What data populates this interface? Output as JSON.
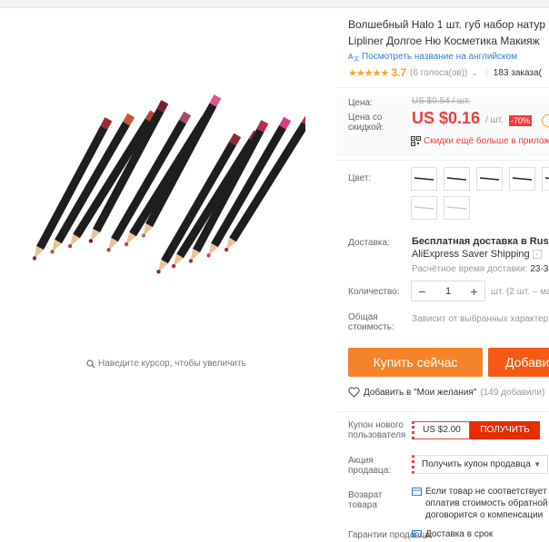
{
  "product": {
    "title_line1": "Волшебный Halo 1 шт. губ набор натур",
    "title_line2": "Lipliner Долгое Ню Косметика Макияж",
    "translate_link": "Посмотреть название на английском",
    "rating_stars": "★★★★★",
    "rating_value": "3.7",
    "votes": "(6 голоса(ов))",
    "votes_chevron": "⌄",
    "orders": "183 заказа(",
    "zoom_hint": "Наведите курсор, чтобы увеличить",
    "image_icon": "lip-pencils-photo"
  },
  "price": {
    "label": "Цена:",
    "old_value": "US $0.54 / шт.",
    "discount_label_1": "Цена со",
    "discount_label_2": "скидкой:",
    "value": "US $0.16",
    "unit": "/ шт.",
    "discount_badge": "-70%",
    "app_promo": "Скидки ещё больше в прилож"
  },
  "options": {
    "color_label": "Цвет:"
  },
  "delivery": {
    "label": "Доставка:",
    "free": "Бесплатная доставка в Russian",
    "method": "AliExpress Saver Shipping",
    "time_label": "Расчётное время доставки:",
    "time_value": "23-3"
  },
  "quantity": {
    "label": "Количество:",
    "minus": "−",
    "value": "1",
    "plus": "+",
    "note": "шт. (2 шт. – ма"
  },
  "total": {
    "label_1": "Общая",
    "label_2": "стоимость:",
    "note": "Зависит от выбранных характер"
  },
  "actions": {
    "buy_now": "Купить сейчас",
    "add_to_cart": "Добавить",
    "wishlist": "Добавить в \"Мои желания\"",
    "wishlist_count": "(149 добавили)"
  },
  "coupon": {
    "label_1": "Купон нового",
    "label_2": "пользователя",
    "label_3": "",
    "value": "US $2.00",
    "get_button": "ПОЛУЧИТЬ"
  },
  "promo": {
    "label_1": "Акция",
    "label_2": "продавца:",
    "select_value": "Получить купон продавца",
    "caret": "▼"
  },
  "returns": {
    "label_1": "Возврат",
    "label_2": "товара",
    "line1": "Если товар не соответствует о",
    "line2": "оплатив стоимость обратной",
    "line3": "договорится о компенсации"
  },
  "guarantee": {
    "label": "Гарантии продавца:",
    "text": "Доставка в срок"
  },
  "colors": {
    "price_red": "#f03d3d",
    "buy_orange": "#f5832a",
    "cart_orange": "#f55a14",
    "star_gold": "#f5a623",
    "link_blue": "#2e7fd6"
  }
}
